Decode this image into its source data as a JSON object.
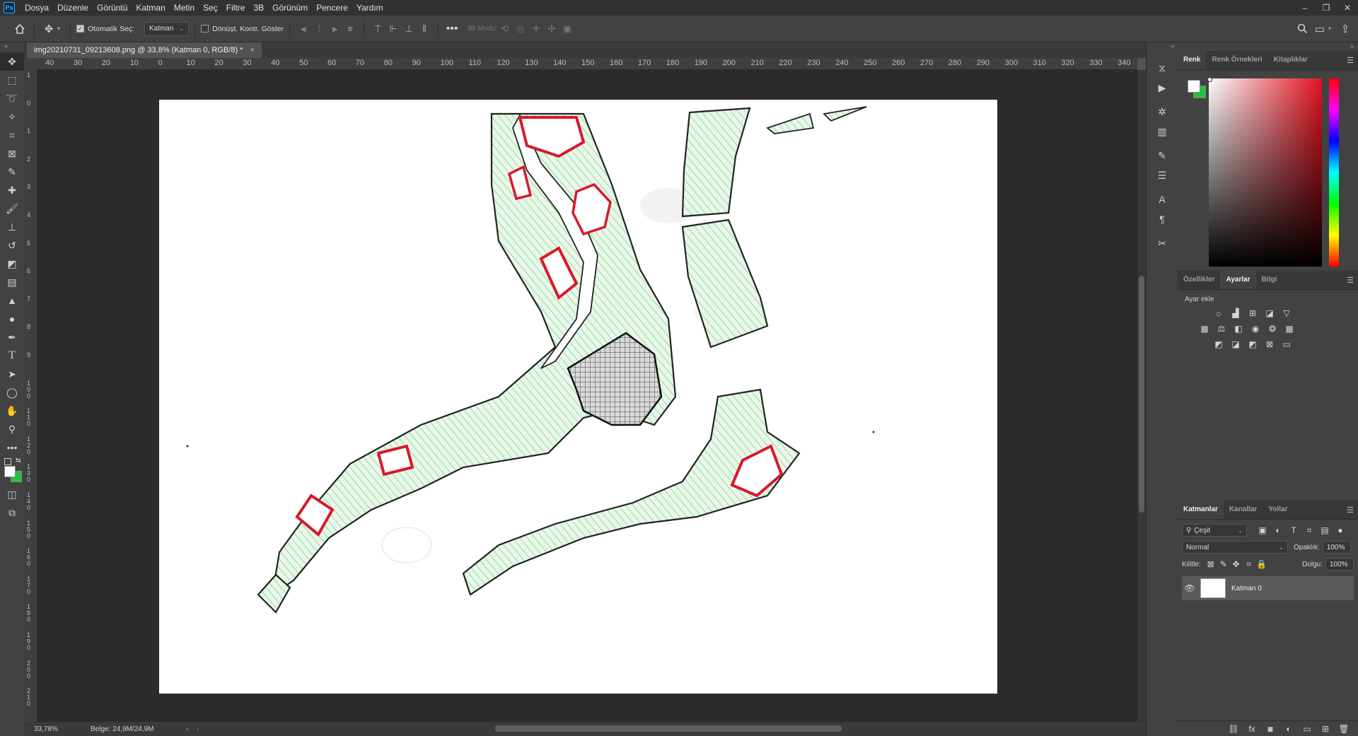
{
  "app": {
    "logo": "Ps"
  },
  "menu": [
    "Dosya",
    "Düzenle",
    "Görüntü",
    "Katman",
    "Metin",
    "Seç",
    "Filtre",
    "3B",
    "Görünüm",
    "Pencere",
    "Yardım"
  ],
  "window_controls": {
    "minimize": "–",
    "restore": "❐",
    "close": "✕"
  },
  "options": {
    "auto_select_label": "Otomatik Seç:",
    "auto_select_value": "Katman",
    "transform_controls_label": "Dönüşt. Kontr. Göster",
    "mode3d_label": "3B Modu:"
  },
  "document": {
    "tab_title": "img20210731_09213608.png @ 33,8% (Katman 0, RGB/8) *",
    "close": "×"
  },
  "ruler_top": [
    "40",
    "30",
    "20",
    "10",
    "0",
    "10",
    "20",
    "30",
    "40",
    "50",
    "60",
    "70",
    "80",
    "90",
    "100",
    "110",
    "120",
    "130",
    "140",
    "150",
    "160",
    "170",
    "180",
    "190",
    "200",
    "210",
    "220",
    "230",
    "240",
    "250",
    "260",
    "270",
    "280",
    "290",
    "300",
    "310",
    "320",
    "330",
    "340"
  ],
  "ruler_left": [
    "1",
    "0",
    "1",
    "2",
    "3",
    "4",
    "5",
    "6",
    "7",
    "8",
    "9",
    "1 0 0",
    "1 1 0",
    "1 2 0",
    "1 3 0",
    "1 4 0",
    "1 5 0",
    "1 6 0",
    "1 7 0",
    "1 8 0",
    "1 9 0",
    "2 0 0",
    "2 1 0"
  ],
  "status": {
    "zoom": "33,78%",
    "doc_size": "Belge: 24,9M/24,9M"
  },
  "color_panel": {
    "tabs": [
      "Renk",
      "Renk Örnekleri",
      "Kitaplıklar"
    ],
    "foreground": "#ffffff",
    "background": "#22c33a"
  },
  "adjustments_panel": {
    "tabs": [
      "Özellikler",
      "Ayarlar",
      "Bilgi"
    ],
    "add_label": "Ayar ekle"
  },
  "layers_panel": {
    "tabs": [
      "Katmanlar",
      "Kanallar",
      "Yollar"
    ],
    "filter_kind": "Çeşit",
    "blend_mode": "Normal",
    "opacity_label": "Opaklık:",
    "opacity_value": "100%",
    "lock_label": "Kilitle:",
    "fill_label": "Dolgu:",
    "fill_value": "100%",
    "layers": [
      {
        "name": "Katman 0",
        "visible": true
      }
    ]
  },
  "colors": {
    "accent_blue": "#31a8ff",
    "sketch_green": "#7fd48a",
    "sketch_red": "#d8192a"
  }
}
